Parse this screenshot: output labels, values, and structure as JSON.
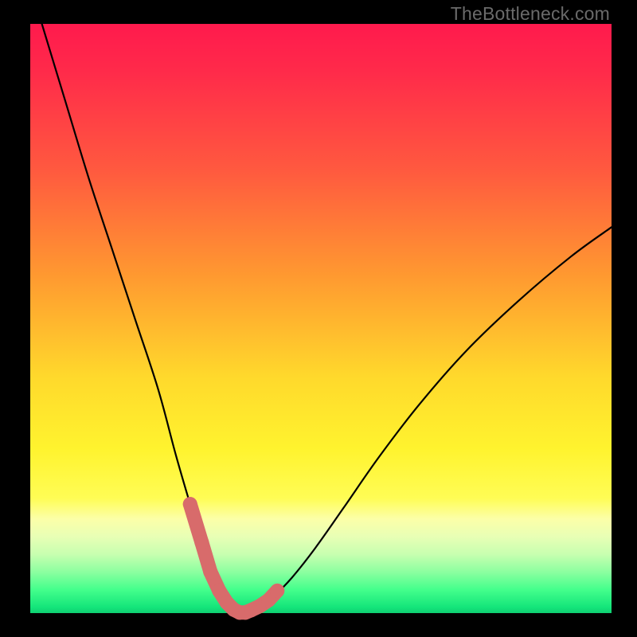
{
  "watermark": "TheBottleneck.com",
  "colors": {
    "page_bg": "#000000",
    "curve": "#000000",
    "marker_fill": "#d86b6b",
    "marker_stroke": "#cf5f5f",
    "gradient_top": "#ff1a4d",
    "gradient_bottom": "#0fcf72"
  },
  "chart_data": {
    "type": "line",
    "title": "",
    "xlabel": "",
    "ylabel": "",
    "xlim": [
      0,
      100
    ],
    "ylim": [
      0,
      100
    ],
    "x": [
      2,
      6,
      10,
      14,
      18,
      22,
      25,
      27.5,
      29.5,
      31,
      32.5,
      33.8,
      35,
      36,
      37,
      38,
      39.5,
      42,
      45,
      49,
      54,
      60,
      67,
      75,
      84,
      93,
      100
    ],
    "values": [
      100,
      87,
      74,
      62,
      50,
      38,
      27,
      18.5,
      12,
      7,
      3.8,
      1.8,
      0.6,
      0.1,
      0.1,
      0.5,
      1.2,
      3,
      6,
      11,
      18,
      26.5,
      35.5,
      44.5,
      53,
      60.5,
      65.5
    ],
    "markers": {
      "x": [
        27.5,
        29.5,
        31,
        32.5,
        33.8,
        35,
        36,
        37,
        38,
        39.5,
        41,
        42.5
      ],
      "values": [
        18.5,
        12,
        7,
        3.8,
        1.8,
        0.6,
        0.1,
        0.1,
        0.5,
        1.2,
        2.2,
        3.8
      ]
    },
    "note": "x/values are in percent of the plot area; (0,0) at bottom-left."
  }
}
